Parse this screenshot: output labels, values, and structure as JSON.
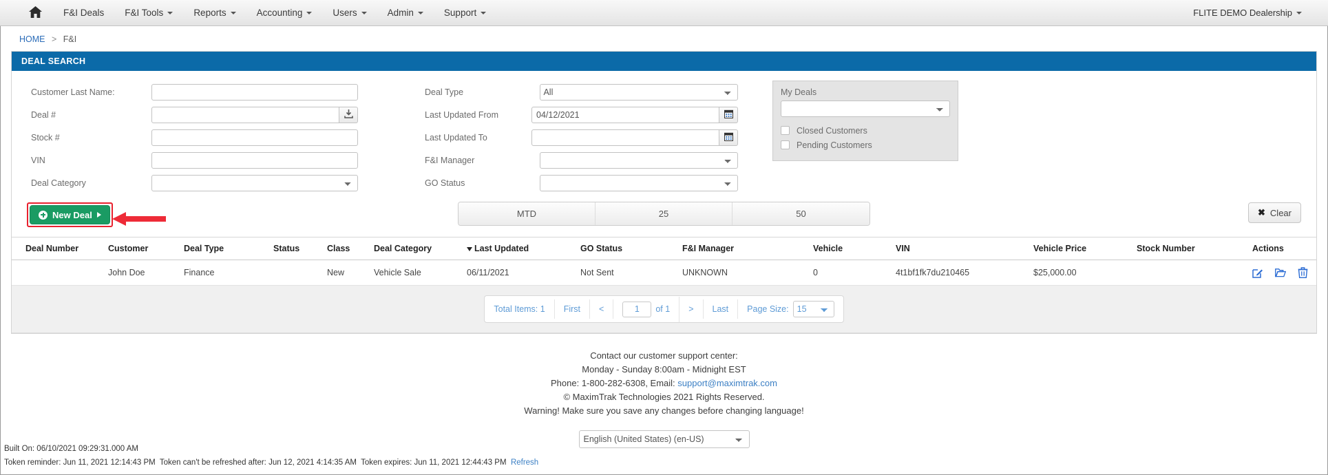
{
  "nav": {
    "home_icon": "home-icon",
    "items": [
      {
        "label": "F&I Deals",
        "caret": false
      },
      {
        "label": "F&I Tools",
        "caret": true
      },
      {
        "label": "Reports",
        "caret": true
      },
      {
        "label": "Accounting",
        "caret": true
      },
      {
        "label": "Users",
        "caret": true
      },
      {
        "label": "Admin",
        "caret": true
      },
      {
        "label": "Support",
        "caret": true
      }
    ],
    "dealership": "FLITE DEMO Dealership"
  },
  "breadcrumb": {
    "home": "HOME",
    "separator": ">",
    "current": "F&I"
  },
  "panel": {
    "title": "DEAL SEARCH"
  },
  "search": {
    "customer_last_name": {
      "label": "Customer Last Name:",
      "value": ""
    },
    "deal_number": {
      "label": "Deal #",
      "value": "",
      "icon": "import-icon"
    },
    "stock_number": {
      "label": "Stock #",
      "value": ""
    },
    "vin": {
      "label": "VIN",
      "value": ""
    },
    "deal_category": {
      "label": "Deal Category",
      "value": ""
    },
    "deal_type": {
      "label": "Deal Type",
      "value": "All"
    },
    "last_updated_from": {
      "label": "Last Updated From",
      "value": "04/12/2021",
      "icon": "calendar-icon"
    },
    "last_updated_to": {
      "label": "Last Updated To",
      "value": "",
      "icon": "calendar-icon"
    },
    "fi_manager": {
      "label": "F&I Manager",
      "value": ""
    },
    "go_status": {
      "label": "GO Status",
      "value": ""
    }
  },
  "my_deals": {
    "title": "My Deals",
    "select_value": "",
    "closed_customers": {
      "label": "Closed Customers",
      "checked": false
    },
    "pending_customers": {
      "label": "Pending Customers",
      "checked": false
    }
  },
  "actions": {
    "new_deal": "New Deal",
    "clear": "Clear",
    "range_buttons": [
      "MTD",
      "25",
      "50"
    ],
    "highlight_color": "#e8212e",
    "new_deal_color": "#1a9b63"
  },
  "results": {
    "columns": [
      "Deal Number",
      "Customer",
      "Deal Type",
      "Status",
      "Class",
      "Deal Category",
      "Last Updated",
      "GO Status",
      "F&I Manager",
      "Vehicle",
      "VIN",
      "Vehicle Price",
      "Stock Number",
      "Actions"
    ],
    "sorted_column": "Last Updated",
    "sort_direction": "desc",
    "rows": [
      {
        "deal_number": "",
        "customer": "John Doe",
        "deal_type": "Finance",
        "status": "",
        "class": "New",
        "deal_category": "Vehicle Sale",
        "last_updated": "06/11/2021",
        "go_status": "Not Sent",
        "fi_manager": "UNKNOWN",
        "vehicle": "0",
        "vin": "4t1bf1fk7du210465",
        "vehicle_price": "$25,000.00",
        "stock_number": "",
        "actions": [
          "edit-icon",
          "open-folder-icon",
          "delete-icon"
        ]
      }
    ]
  },
  "pagination": {
    "total_items": "Total Items: 1",
    "first": "First",
    "prev": "<",
    "page_value": "1",
    "of_pages": "of 1",
    "next": ">",
    "last": "Last",
    "page_size_label": "Page Size:",
    "page_size_value": "15"
  },
  "footer": {
    "line1": "Contact our customer support center:",
    "line2": "Monday - Sunday 8:00am - Midnight EST",
    "phone_prefix": "Phone: 1-800-282-6308, Email: ",
    "email": "support@maximtrak.com",
    "copyright": "© MaximTrak Technologies 2021 Rights Reserved.",
    "warning": "Warning! Make sure you save any changes before changing language!",
    "language": "English (United States) (en-US)"
  },
  "build_info": {
    "built_on": "Built On: 06/10/2021 09:29:31.000 AM",
    "token_reminder": "Token reminder: Jun 11, 2021 12:14:43 PM",
    "token_refresh": "Token can't be refreshed after: Jun 12, 2021 4:14:35 AM",
    "token_expires": "Token expires: Jun 11, 2021 12:44:43 PM",
    "refresh_link": "Refresh"
  }
}
